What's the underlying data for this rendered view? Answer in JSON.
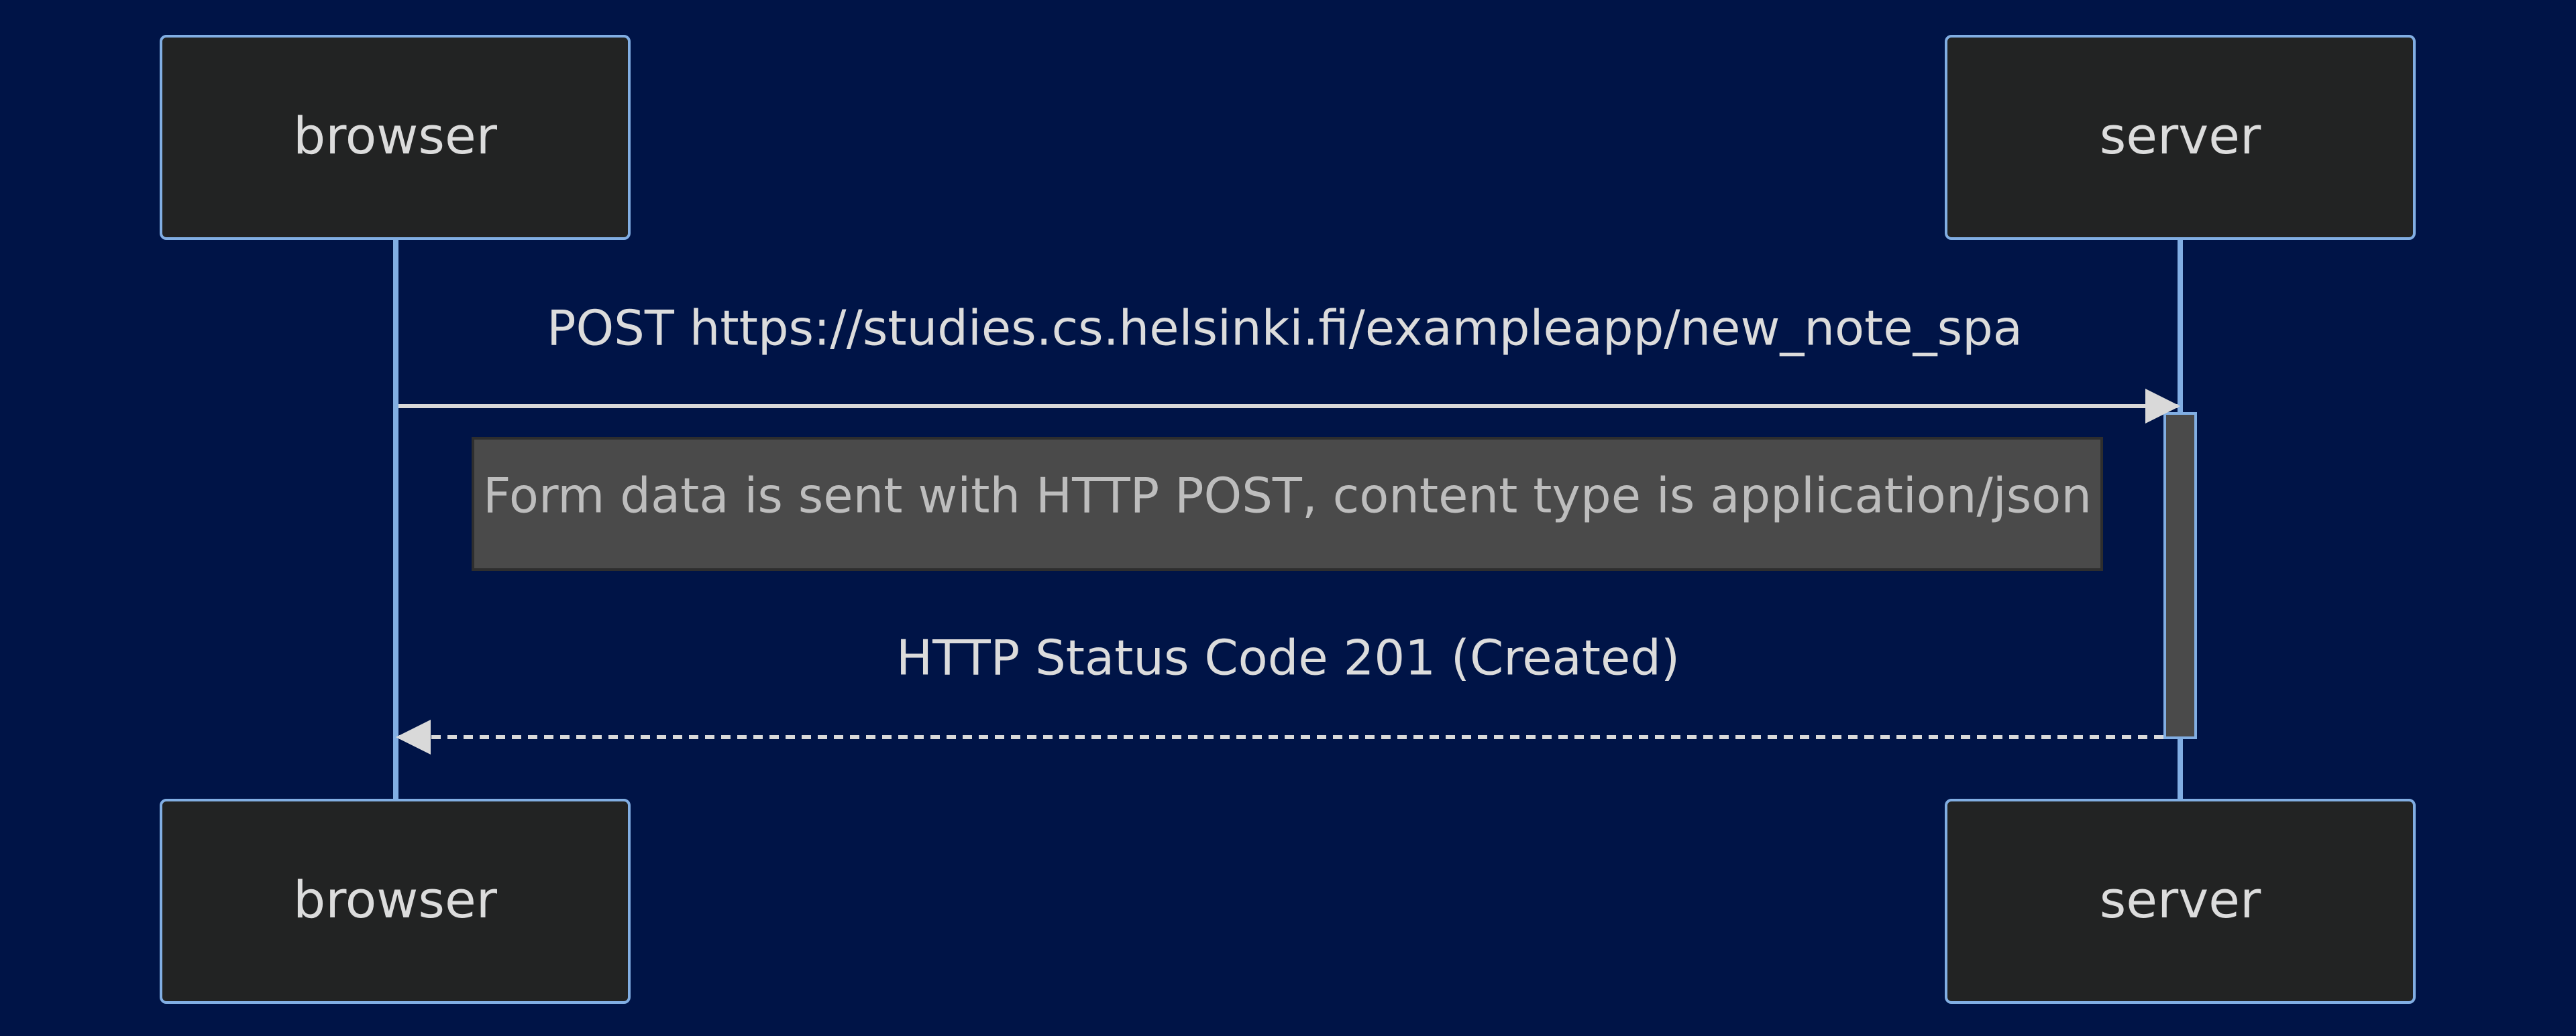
{
  "colors": {
    "background": "#001447",
    "actor_fill": "#222323",
    "actor_border": "#81aee3",
    "lifeline": "#81aee3",
    "arrow": "#d9d9d9",
    "text": "#dcdcdc",
    "note_fill": "#4a4a4a",
    "note_border": "#2e2e2e",
    "note_text": "#bdbdbd",
    "activation_fill": "#4a4a4a"
  },
  "actors": {
    "browser": "browser",
    "server": "server"
  },
  "messages": [
    {
      "from": "browser",
      "to": "server",
      "style": "solid",
      "label": "POST https://studies.cs.helsinki.fi/exampleapp/new_note_spa"
    },
    {
      "from": "server",
      "to": "browser",
      "style": "dashed",
      "label": "HTTP Status Code 201 (Created)"
    }
  ],
  "note": {
    "text": "Form data is sent with HTTP POST, content type is application/json"
  }
}
